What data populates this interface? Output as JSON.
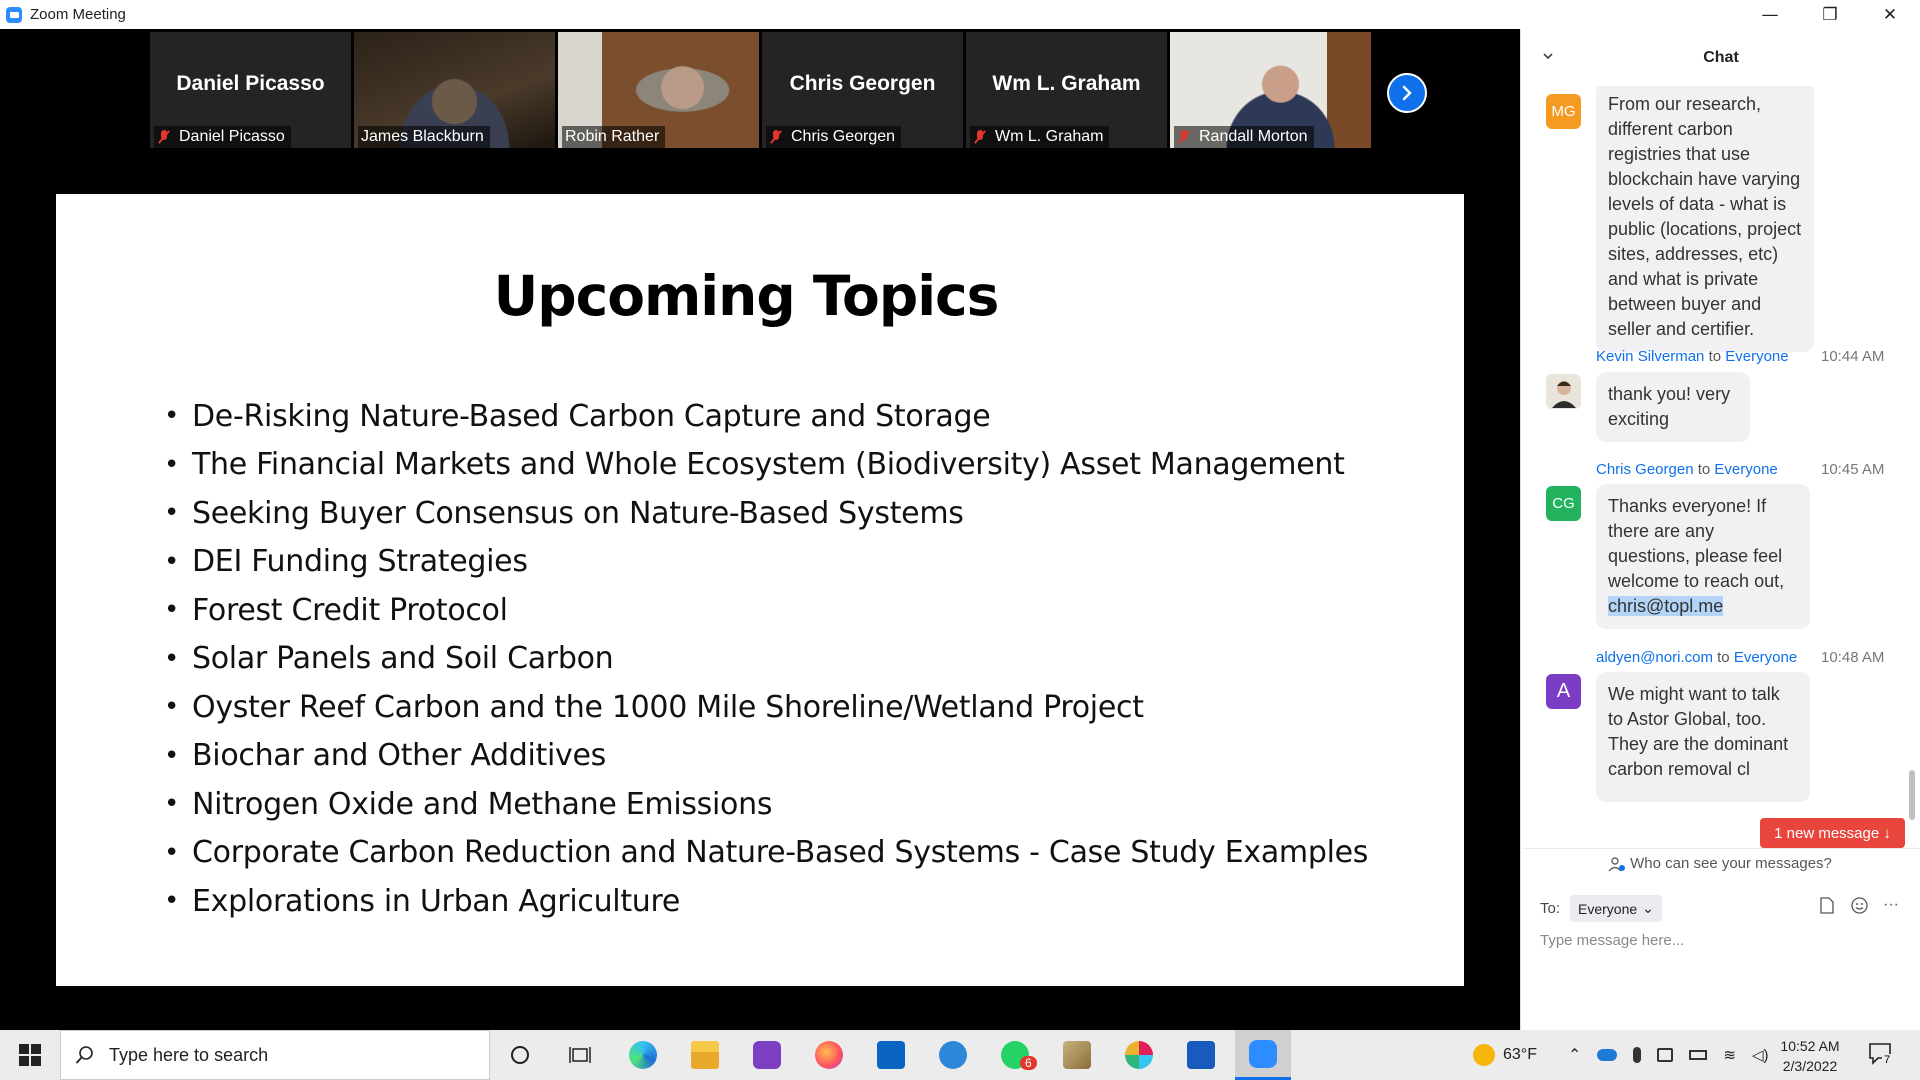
{
  "window": {
    "title": "Zoom Meeting",
    "minimize": "—",
    "restore": "❐",
    "close": "✕"
  },
  "participants": [
    {
      "name": "Daniel Picasso",
      "video": false,
      "muted": true
    },
    {
      "name": "James Blackburn",
      "video": true,
      "muted": false,
      "active": true
    },
    {
      "name": "Robin Rather",
      "video": true,
      "muted": false
    },
    {
      "name": "Chris Georgen",
      "video": false,
      "muted": true
    },
    {
      "name": "Wm L. Graham",
      "video": false,
      "muted": true
    },
    {
      "name": "Randall Morton",
      "video": true,
      "muted": true
    }
  ],
  "slide": {
    "title": "Upcoming Topics",
    "bullets": [
      "De-Risking Nature-Based Carbon Capture and Storage",
      "The Financial Markets and Whole Ecosystem (Biodiversity) Asset Management",
      "Seeking Buyer Consensus on Nature-Based Systems",
      "DEI Funding Strategies",
      "Forest Credit Protocol",
      "Solar Panels and Soil Carbon",
      "Oyster Reef Carbon and the 1000 Mile Shoreline/Wetland Project",
      "Biochar and Other Additives",
      "Nitrogen Oxide and Methane Emissions",
      "Corporate Carbon Reduction and Nature-Based Systems -  Case Study Examples",
      "Explorations in Urban Agriculture"
    ]
  },
  "chat": {
    "title": "Chat",
    "messages": [
      {
        "initials": "MG",
        "avatar_color": "#f59a23",
        "text": "From our research, different carbon registries that use blockchain have varying levels of data - what is public (locations, project sites, addresses, etc) and what is private between buyer and seller and certifier."
      },
      {
        "sender": "Kevin Silverman",
        "to": "to",
        "recipient": "Everyone",
        "time": "10:44 AM",
        "text": "thank you! very exciting"
      },
      {
        "sender": "Chris Georgen",
        "to": "to",
        "recipient": "Everyone",
        "time": "10:45 AM",
        "initials": "CG",
        "avatar_color": "#23b35f",
        "text": "Thanks everyone! If there are any questions, please feel welcome to reach out,",
        "link": "chris@topl.me"
      },
      {
        "sender": "aldyen@nori.com",
        "to": "to",
        "recipient": "Everyone",
        "time": "10:48 AM",
        "initials": "A",
        "avatar_color": "#7a3dc4",
        "text": "We might want to talk to Astor Global, too. They are the dominant carbon removal cl"
      }
    ],
    "new_message_label": "1 new message ↓",
    "who_can_see": "Who can see your messages?",
    "to_label": "To:",
    "to_value": "Everyone",
    "input_placeholder": "Type message here...",
    "more": "···"
  },
  "taskbar": {
    "search_placeholder": "Type here to search",
    "weather": "63°F",
    "time": "10:52 AM",
    "date": "2/3/2022",
    "whatsapp_badge": "6",
    "notification_count": "7"
  }
}
